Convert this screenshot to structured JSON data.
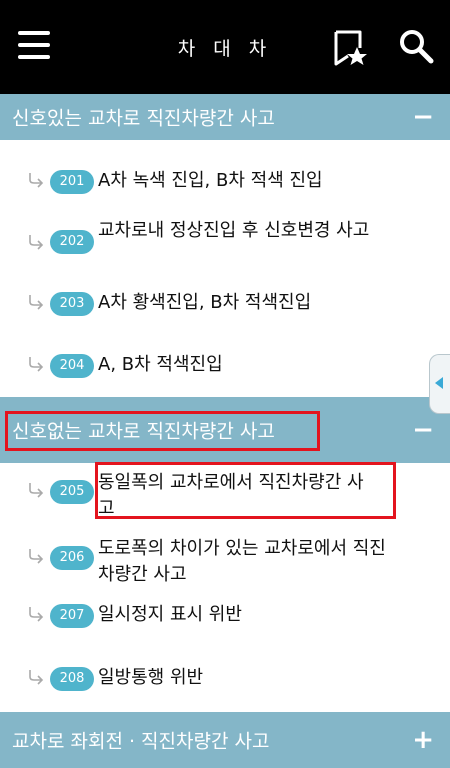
{
  "header": {
    "title": "차 대 차",
    "icons": {
      "menu": "menu-icon",
      "bookmark": "bookmark-star-icon",
      "search": "search-icon"
    }
  },
  "sections": [
    {
      "title": "신호있는 교차로 직진차량간 사고",
      "toggle": "−",
      "items": [
        {
          "code": "201",
          "text": "A차 녹색 진입, B차 적색 진입"
        },
        {
          "code": "202",
          "text": "교차로내 정상진입 후 신호변경 사고"
        },
        {
          "code": "203",
          "text": "A차 황색진입, B차 적색진입"
        },
        {
          "code": "204",
          "text": "A, B차 적색진입"
        }
      ]
    },
    {
      "title": "신호없는 교차로 직진차량간 사고",
      "toggle": "−",
      "items": [
        {
          "code": "205",
          "text": "동일폭의 교차로에서 직진차량간 사고"
        },
        {
          "code": "206",
          "text": "도로폭의 차이가 있는 교차로에서 직진차량간 사고"
        },
        {
          "code": "207",
          "text": "일시정지 표시 위반"
        },
        {
          "code": "208",
          "text": "일방통행 위반"
        }
      ]
    },
    {
      "title": "교차로 좌회전 · 직진차량간 사고",
      "toggle": "+"
    }
  ],
  "colors": {
    "topbar": "#000000",
    "section": "#84b6c8",
    "badge": "#4fb4cc",
    "highlight": "#e3141e"
  }
}
